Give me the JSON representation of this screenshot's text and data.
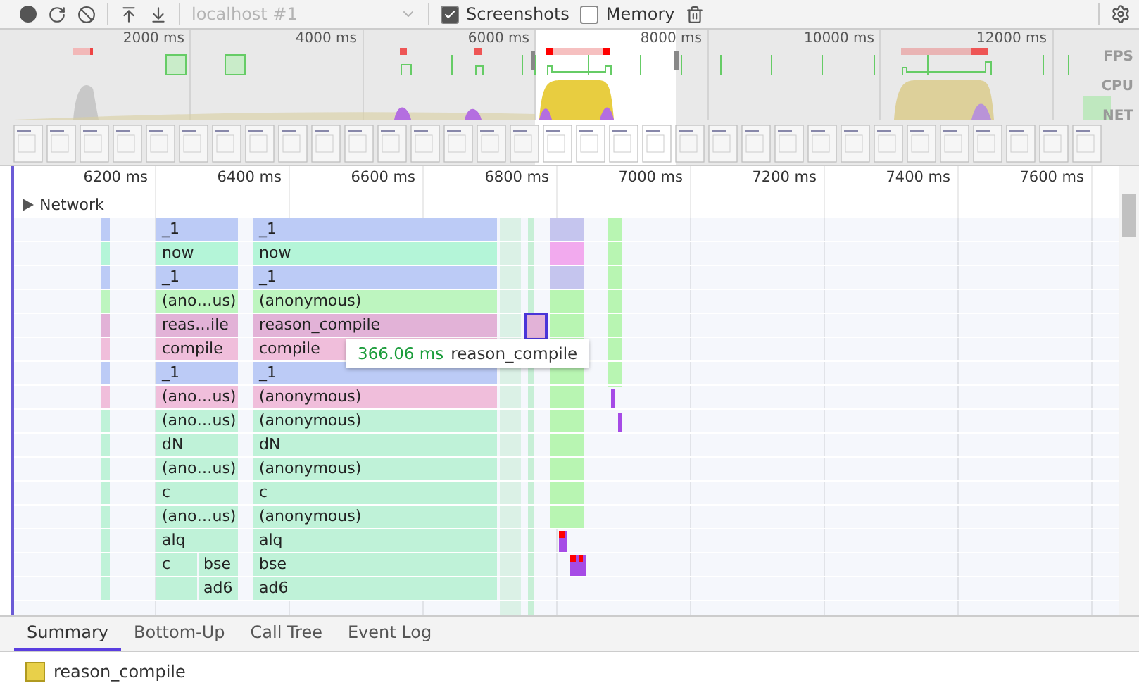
{
  "toolbar": {
    "target": {
      "value": "localhost #1",
      "disabled": true
    },
    "checkboxes": [
      {
        "label": "Screenshots",
        "checked": true
      },
      {
        "label": "Memory",
        "checked": false
      }
    ]
  },
  "overview": {
    "ticks": [
      "2000 ms",
      "4000 ms",
      "6000 ms",
      "8000 ms",
      "10000 ms",
      "12000 ms"
    ],
    "tracks": [
      "FPS",
      "CPU",
      "NET"
    ]
  },
  "timeline": {
    "ticks": [
      "6200 ms",
      "6400 ms",
      "6600 ms",
      "6800 ms",
      "7000 ms",
      "7200 ms",
      "7400 ms",
      "7600 ms"
    ],
    "network": {
      "label": "Network",
      "expanded": false
    },
    "rows": [
      {
        "color": "#bccbf6",
        "selected": false,
        "left": [
          {
            "kind": "frame",
            "label": "_1"
          }
        ],
        "right": "_1"
      },
      {
        "color": "#b4f5d8",
        "selected": false,
        "left": [
          {
            "kind": "frame",
            "label": "now"
          }
        ],
        "right": "now"
      },
      {
        "color": "#bccbf6",
        "selected": false,
        "left": [
          {
            "kind": "frame",
            "label": "_1"
          }
        ],
        "right": "_1"
      },
      {
        "color": "#bdf5bf",
        "selected": false,
        "left": [
          {
            "kind": "frame",
            "label": "(ano…us)"
          }
        ],
        "right": "(anonymous)"
      },
      {
        "color": "#e2b2d7",
        "selected": true,
        "left": [
          {
            "kind": "frame",
            "label": "reas…ile"
          }
        ],
        "right": "reason_compile"
      },
      {
        "color": "#f0bedb",
        "selected": false,
        "left": [
          {
            "kind": "frame",
            "label": "compile"
          }
        ],
        "right": "compile"
      },
      {
        "color": "#bccbf6",
        "selected": false,
        "left": [
          {
            "kind": "frame",
            "label": "_1"
          }
        ],
        "right": "_1"
      },
      {
        "color": "#f0bedb",
        "selected": false,
        "left": [
          {
            "kind": "frame",
            "label": "(ano…us)"
          }
        ],
        "right": "(anonymous)"
      },
      {
        "color": "#bff2d8",
        "selected": false,
        "left": [
          {
            "kind": "frame",
            "label": "(ano…us)"
          }
        ],
        "right": "(anonymous)"
      },
      {
        "color": "#bff2d8",
        "selected": false,
        "left": [
          {
            "kind": "frame",
            "label": "dN"
          }
        ],
        "right": "dN"
      },
      {
        "color": "#bff2d8",
        "selected": false,
        "left": [
          {
            "kind": "frame",
            "label": "(ano…us)"
          }
        ],
        "right": "(anonymous)"
      },
      {
        "color": "#bff2d8",
        "selected": false,
        "left": [
          {
            "kind": "frame",
            "label": "c"
          }
        ],
        "right": "c"
      },
      {
        "color": "#bff2d8",
        "selected": false,
        "left": [
          {
            "kind": "frame",
            "label": "(ano…us)"
          }
        ],
        "right": "(anonymous)"
      },
      {
        "color": "#bff2d8",
        "selected": false,
        "left": [
          {
            "kind": "frame",
            "label": "alq"
          }
        ],
        "right": "alq"
      },
      {
        "color": "#bff2d8",
        "selected": false,
        "left": [
          {
            "kind": "frame",
            "label": "c"
          },
          {
            "kind": "frame",
            "label": "bse"
          }
        ],
        "right": "bse"
      },
      {
        "color": "#bff2d8",
        "selected": false,
        "left": [
          {
            "kind": "blank"
          },
          {
            "kind": "frame",
            "label": "ad6"
          }
        ],
        "right": "ad6"
      }
    ],
    "tooltip": {
      "duration": "366.06 ms",
      "name": "reason_compile"
    }
  },
  "bottom": {
    "tabs": [
      {
        "label": "Summary",
        "selected": true
      },
      {
        "label": "Bottom-Up",
        "selected": false
      },
      {
        "label": "Call Tree",
        "selected": false
      },
      {
        "label": "Event Log",
        "selected": false
      }
    ],
    "summary": {
      "name": "reason_compile",
      "color": "#e8d04a"
    }
  }
}
